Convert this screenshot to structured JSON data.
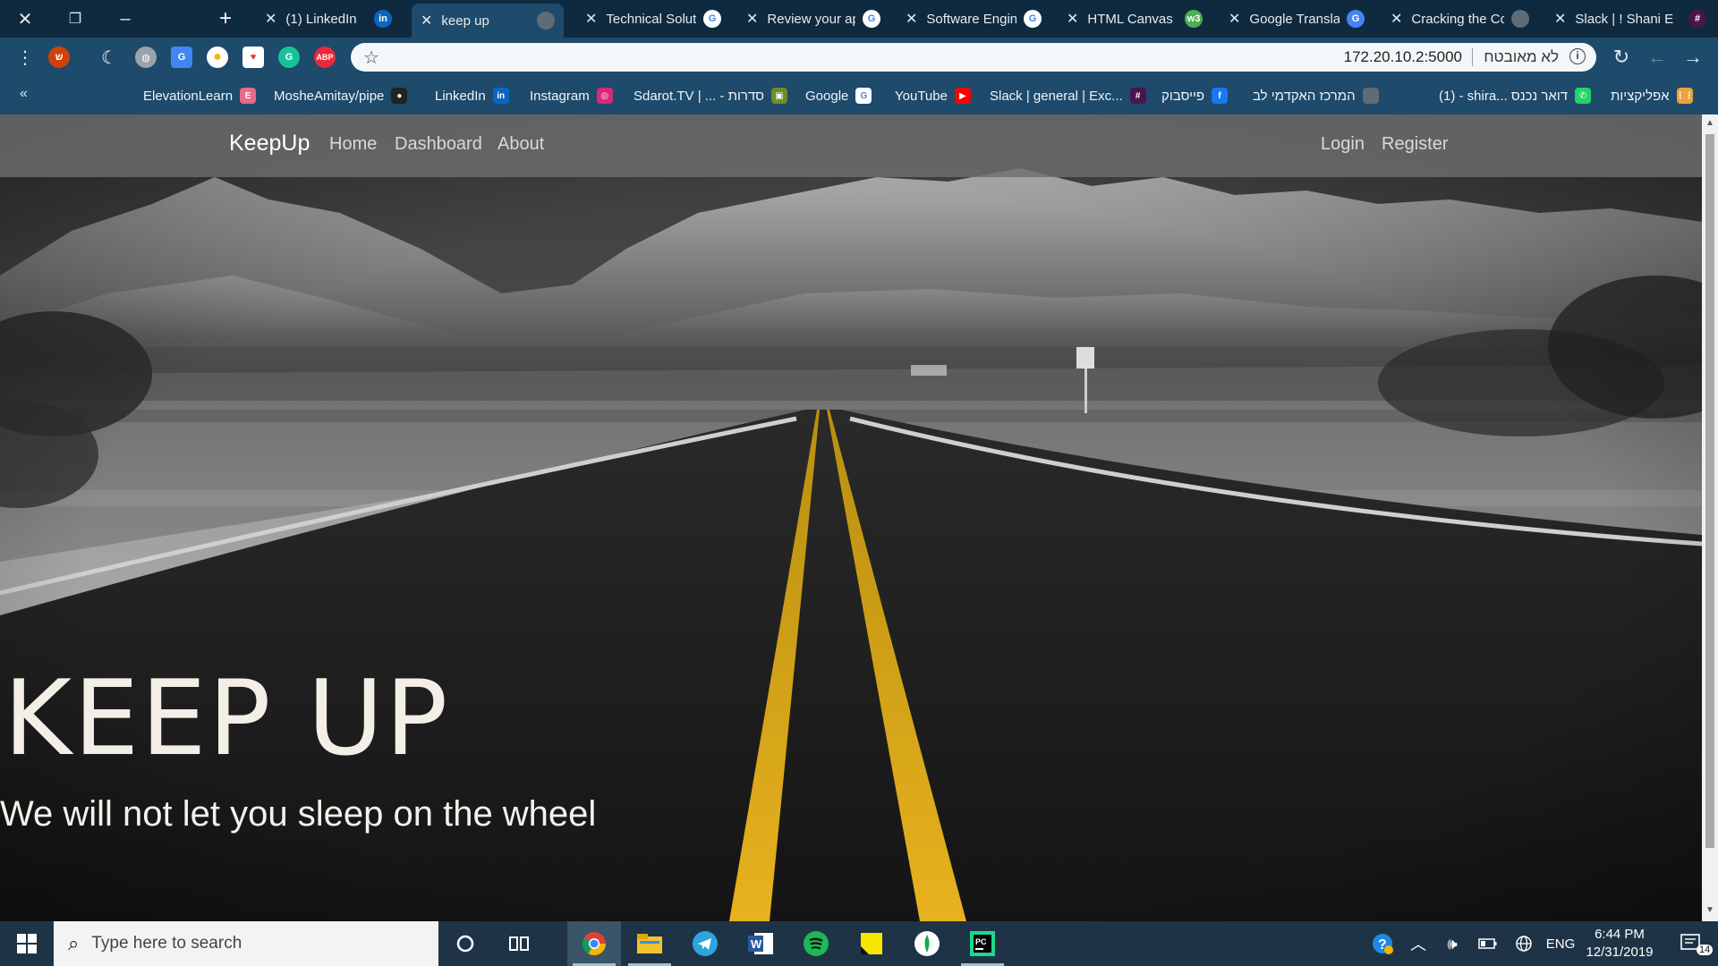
{
  "browser": {
    "tabs": [
      {
        "title": "(1) LinkedIn",
        "favicon": "linkedin-icon",
        "color": "#0a66c2",
        "glyph": "in"
      },
      {
        "title": "keep up",
        "favicon": "globe-icon",
        "color": "#5f6b75",
        "glyph": "",
        "active": true
      },
      {
        "title": "Technical Soluti",
        "favicon": "google-icon",
        "color": "#ffffff",
        "glyph": "G"
      },
      {
        "title": "Review your ap",
        "favicon": "google-icon",
        "color": "#ffffff",
        "glyph": "G"
      },
      {
        "title": "Software Engin",
        "favicon": "google-icon",
        "color": "#ffffff",
        "glyph": "G"
      },
      {
        "title": "HTML Canvas",
        "favicon": "w3schools-icon",
        "color": "#4caf50",
        "glyph": "w3"
      },
      {
        "title": "Google Translat",
        "favicon": "google-translate-icon",
        "color": "#4285f4",
        "glyph": "G"
      },
      {
        "title": "Cracking the Co",
        "favicon": "globe-icon",
        "color": "#5f6b75",
        "glyph": ""
      },
      {
        "title": "Slack | ! Shani E",
        "favicon": "slack-icon",
        "color": "#4a154b",
        "glyph": "#"
      }
    ],
    "address": {
      "url": "172.20.10.2:5000",
      "security_text": "לא מאובטח"
    },
    "bookmarks": [
      {
        "label": "ElevationLearn",
        "icon": "elevation-icon",
        "color": "#e66a8a",
        "glyph": "E"
      },
      {
        "label": "MosheAmitay/pipe",
        "icon": "github-icon",
        "color": "#222222",
        "glyph": "●"
      },
      {
        "label": "LinkedIn",
        "icon": "linkedin-icon",
        "color": "#0a66c2",
        "glyph": "in"
      },
      {
        "label": "Instagram",
        "icon": "instagram-icon",
        "color": "#d62976",
        "glyph": "◎"
      },
      {
        "label": "Sdarot.TV | ... - סדרות",
        "icon": "sdarot-icon",
        "color": "#6b8e23",
        "glyph": "▣"
      },
      {
        "label": "Google",
        "icon": "google-icon",
        "color": "#ffffff",
        "glyph": "G"
      },
      {
        "label": "YouTube",
        "icon": "youtube-icon",
        "color": "#ff0000",
        "glyph": "▶"
      },
      {
        "label": "Slack | general | Exc...",
        "icon": "slack-icon",
        "color": "#4a154b",
        "glyph": "#"
      },
      {
        "label": "פייסבוק",
        "icon": "facebook-icon",
        "color": "#1877f2",
        "glyph": "f"
      },
      {
        "label": "המרכז האקדמי לב",
        "icon": "globe-icon",
        "color": "#5f6b75",
        "glyph": ""
      },
      {
        "label": "(1) - shira... דואר נכנס",
        "icon": "whatsapp-gmail-icon",
        "color": "#25d366",
        "glyph": "✆"
      },
      {
        "label": "אפליקציות",
        "icon": "apps-grid-icon",
        "color": "#e8a33d",
        "glyph": "⋮⋮"
      }
    ]
  },
  "site": {
    "brand": "KeepUp",
    "nav_left": [
      "Home",
      "Dashboard",
      "About"
    ],
    "nav_right": [
      "Login",
      "Register"
    ],
    "hero_title": "KEEP UP",
    "hero_subtitle": "We will not let you sleep on the wheel"
  },
  "taskbar": {
    "search_placeholder": "Type here to search",
    "language": "ENG",
    "time": "6:44 PM",
    "date": "12/31/2019",
    "notification_count": "14"
  }
}
